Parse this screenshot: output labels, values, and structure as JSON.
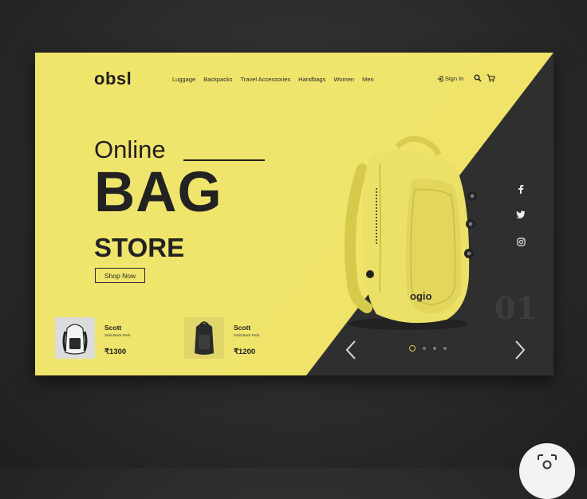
{
  "brand": {
    "logo": "obsl"
  },
  "nav": {
    "items": [
      "Luggage",
      "Backpacks",
      "Travel Accessories",
      "Handbags",
      "Women",
      "Men"
    ]
  },
  "header": {
    "signin_label": "Sign In",
    "search_icon": "search-icon",
    "cart_icon": "cart-icon"
  },
  "hero": {
    "line1": "Online",
    "line2": "BAG",
    "line3": "STORE",
    "cta_label": "Shop Now"
  },
  "products": [
    {
      "name": "Scott",
      "desc": "Solid Back Pack",
      "price": "₹1300"
    },
    {
      "name": "Scott",
      "desc": "Solid Back Pack",
      "price": "₹1200"
    }
  ],
  "social": {
    "icons": [
      "facebook-icon",
      "twitter-icon",
      "instagram-icon"
    ]
  },
  "slider": {
    "slide_number": "01",
    "total_slides": 4,
    "active_slide": 1,
    "prev_icon": "chevron-left-icon",
    "next_icon": "chevron-right-icon"
  },
  "colors": {
    "accent_yellow": "#efe36a",
    "dark_panel": "#303030",
    "text_dark": "#222222"
  }
}
